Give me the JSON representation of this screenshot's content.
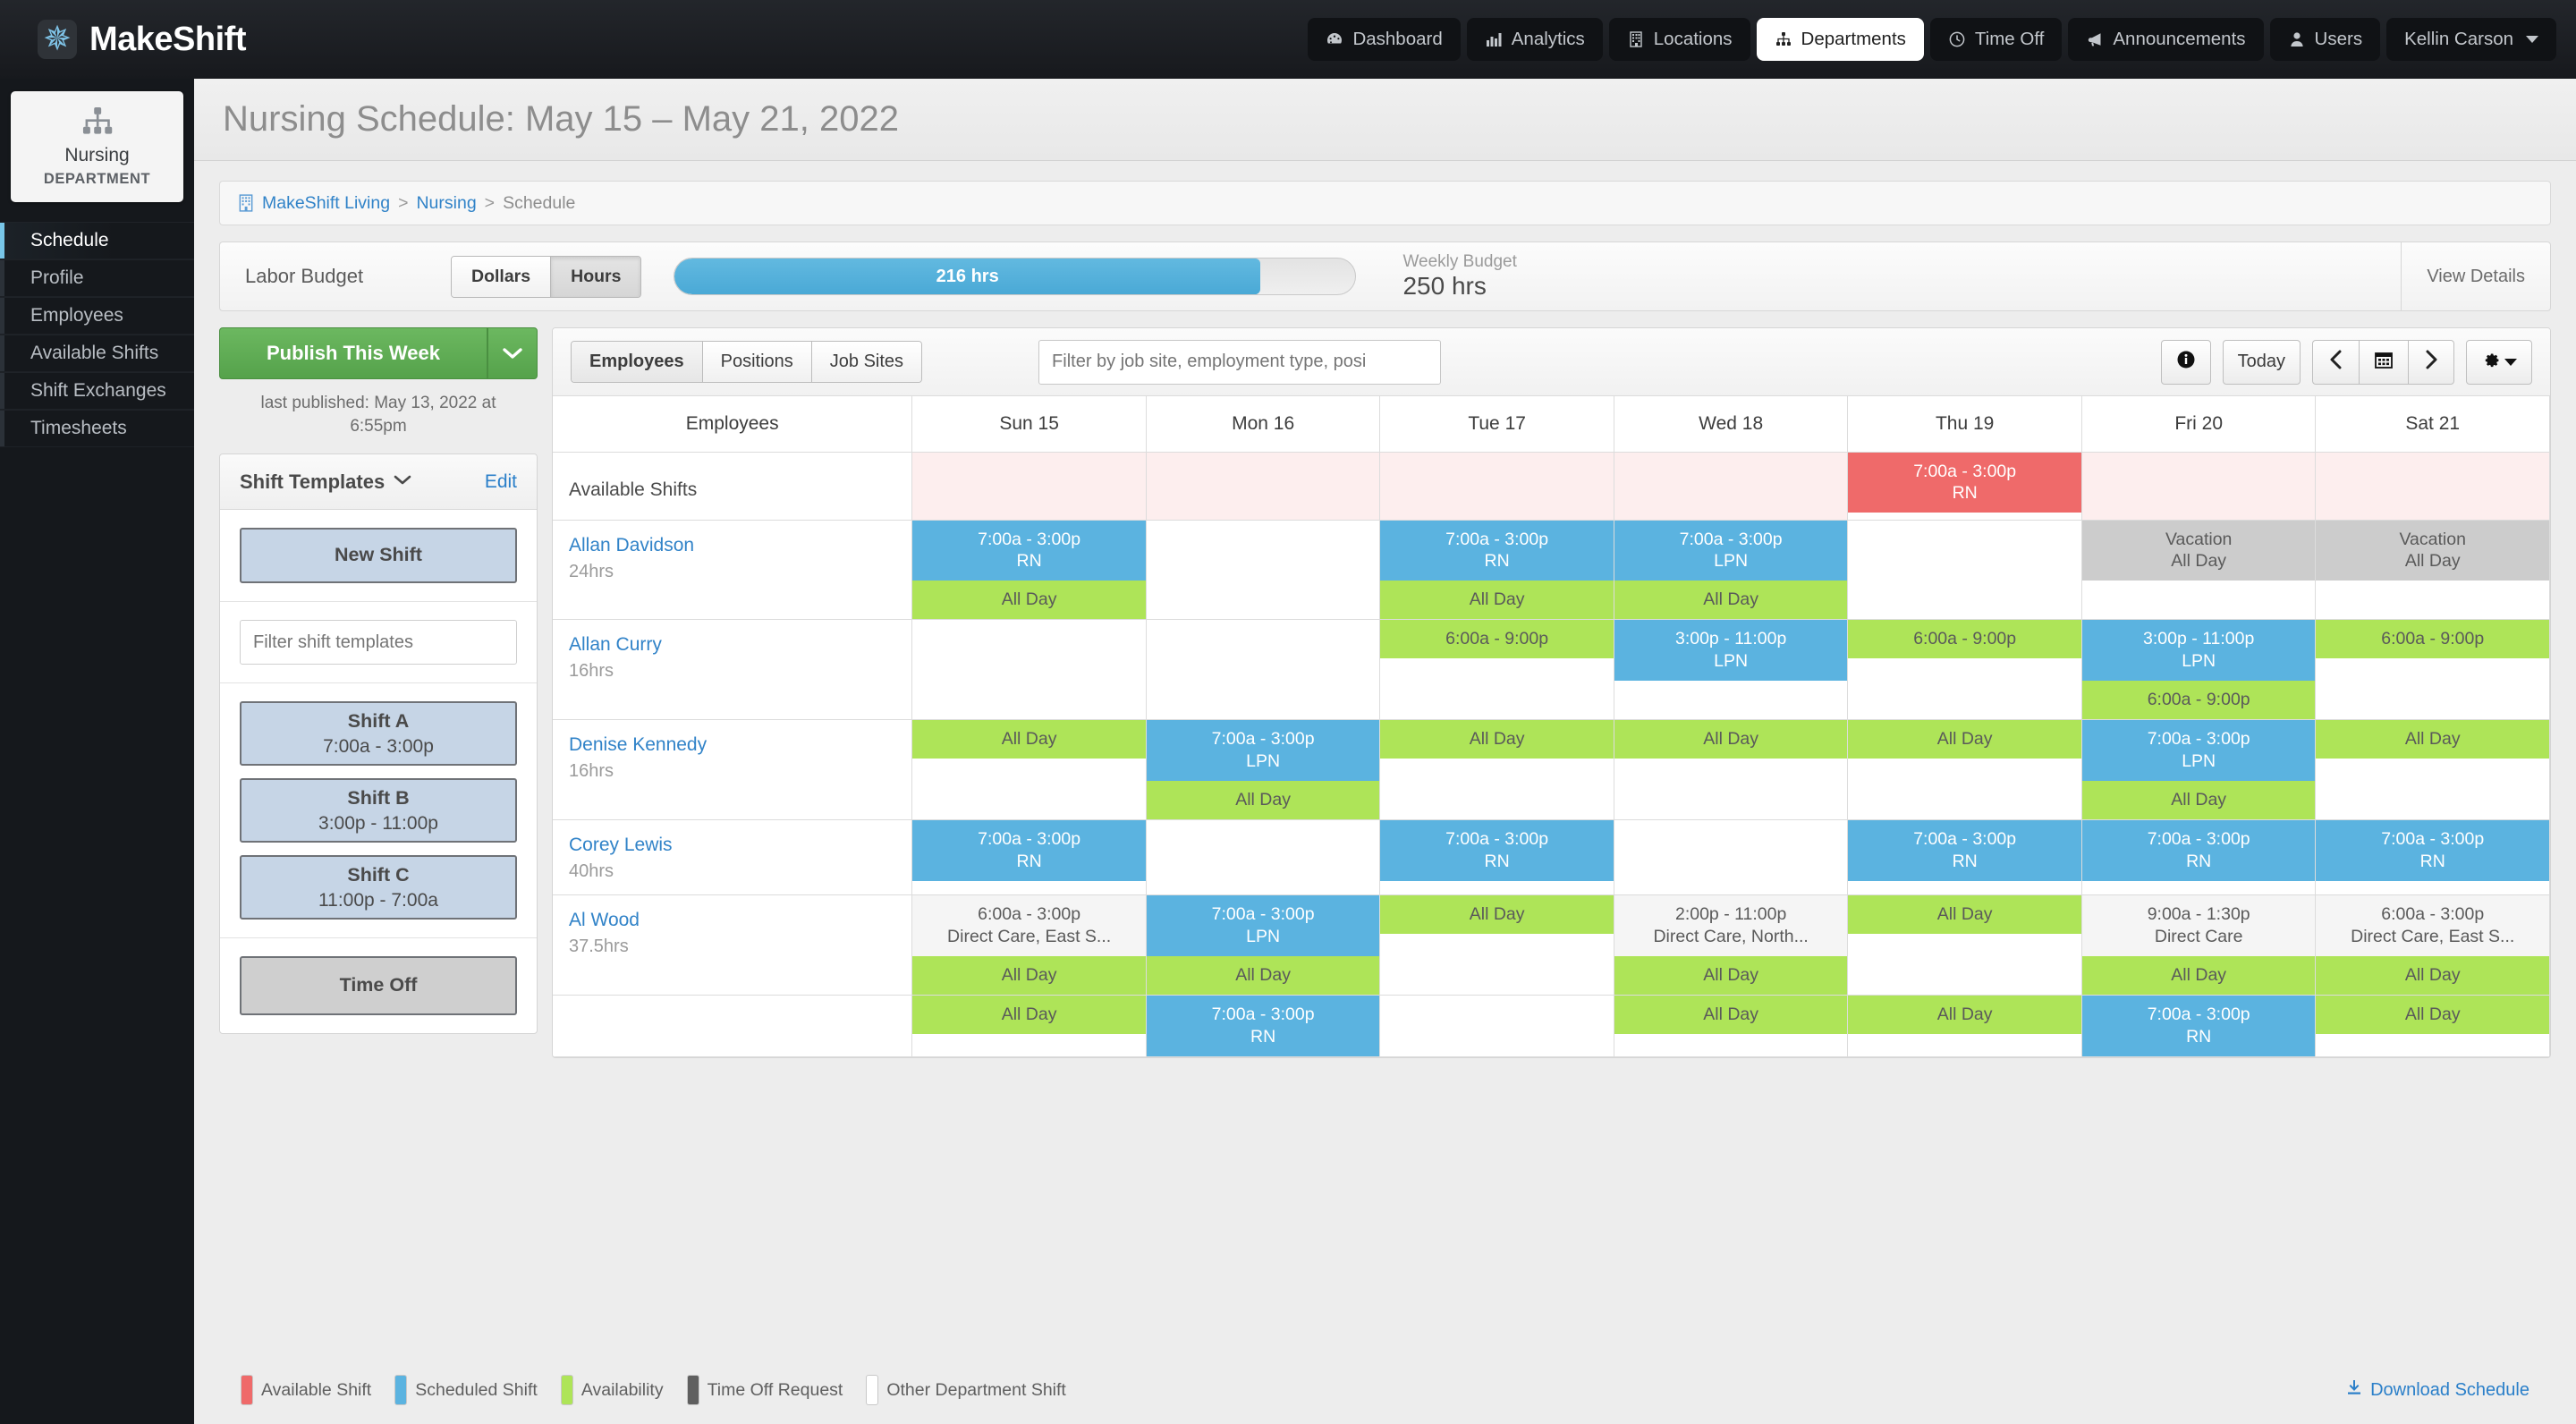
{
  "brand": {
    "name": "MakeShift",
    "logo_icon": "asterisk-icon"
  },
  "topnav": {
    "items": [
      {
        "label": "Dashboard",
        "icon": "dashboard-icon",
        "active": false
      },
      {
        "label": "Analytics",
        "icon": "bar-chart-icon",
        "active": false
      },
      {
        "label": "Locations",
        "icon": "building-icon",
        "active": false
      },
      {
        "label": "Departments",
        "icon": "sitemap-icon",
        "active": true
      },
      {
        "label": "Time Off",
        "icon": "clock-icon",
        "active": false
      },
      {
        "label": "Announcements",
        "icon": "megaphone-icon",
        "active": false
      },
      {
        "label": "Users",
        "icon": "user-icon",
        "active": false
      }
    ],
    "account": {
      "label": "Kellin Carson",
      "icon": "chevron-down-icon"
    }
  },
  "sidebar": {
    "department": {
      "name": "Nursing",
      "subtitle": "DEPARTMENT",
      "icon": "sitemap-icon"
    },
    "items": [
      {
        "label": "Schedule",
        "active": true
      },
      {
        "label": "Profile",
        "active": false
      },
      {
        "label": "Employees",
        "active": false
      },
      {
        "label": "Available Shifts",
        "active": false
      },
      {
        "label": "Shift Exchanges",
        "active": false
      },
      {
        "label": "Timesheets",
        "active": false
      }
    ]
  },
  "page": {
    "title": "Nursing Schedule: May 15 – May 21, 2022"
  },
  "breadcrumb": {
    "icon": "building-icon",
    "items": [
      {
        "label": "MakeShift Living",
        "link": true
      },
      {
        "label": "Nursing",
        "link": true
      },
      {
        "label": "Schedule",
        "link": false
      }
    ],
    "separator": ">"
  },
  "labor_budget": {
    "label": "Labor Budget",
    "toggle": [
      {
        "label": "Dollars",
        "active": false
      },
      {
        "label": "Hours",
        "active": true
      }
    ],
    "progress_text": "216 hrs",
    "progress_percent": 86,
    "weekly_budget_caption": "Weekly Budget",
    "weekly_budget_value": "250 hrs",
    "view_details": "View Details",
    "accent_color": "#4aa9d6"
  },
  "left_panel": {
    "publish_button": "Publish This Week",
    "publish_caret_icon": "chevron-down-icon",
    "last_published": "last published: May 13, 2022 at 6:55pm",
    "templates_panel": {
      "title": "Shift Templates",
      "title_caret_icon": "chevron-down-icon",
      "edit_label": "Edit",
      "new_shift_label": "New Shift",
      "filter_placeholder": "Filter shift templates",
      "templates": [
        {
          "name": "Shift A",
          "time": "7:00a - 3:00p",
          "style": "blue"
        },
        {
          "name": "Shift B",
          "time": "3:00p - 11:00p",
          "style": "blue"
        },
        {
          "name": "Shift C",
          "time": "11:00p - 7:00a",
          "style": "blue"
        }
      ],
      "time_off_label": "Time Off"
    }
  },
  "schedule": {
    "tabs": [
      {
        "label": "Employees",
        "active": true
      },
      {
        "label": "Positions",
        "active": false
      },
      {
        "label": "Job Sites",
        "active": false
      }
    ],
    "filter_placeholder": "Filter by job site, employment type, posi",
    "toolbar": {
      "info_icon": "info-icon",
      "today_label": "Today",
      "prev_icon": "chevron-left-icon",
      "calendar_icon": "calendar-icon",
      "next_icon": "chevron-right-icon",
      "settings_icon": "gear-icon",
      "settings_caret_icon": "caret-down-icon"
    },
    "columns": [
      "Employees",
      "Sun 15",
      "Mon 16",
      "Tue 17",
      "Wed 18",
      "Thu 19",
      "Fri 20",
      "Sat 21"
    ],
    "available_shifts_row": {
      "label": "Available Shifts",
      "cells": [
        {
          "chips": []
        },
        {
          "chips": []
        },
        {
          "chips": []
        },
        {
          "chips": []
        },
        {
          "chips": [
            {
              "style": "red",
              "line1": "7:00a - 3:00p",
              "line2": "RN"
            }
          ]
        },
        {
          "chips": []
        },
        {
          "chips": []
        }
      ]
    },
    "rows": [
      {
        "name": "Allan Davidson",
        "hours": "24hrs",
        "cells": [
          {
            "chips": [
              {
                "style": "blue",
                "line1": "7:00a - 3:00p",
                "line2": "RN"
              },
              {
                "style": "green",
                "line1": "All Day",
                "line2": ""
              }
            ]
          },
          {
            "chips": []
          },
          {
            "chips": [
              {
                "style": "blue",
                "line1": "7:00a - 3:00p",
                "line2": "RN"
              },
              {
                "style": "green",
                "line1": "All Day",
                "line2": ""
              }
            ]
          },
          {
            "chips": [
              {
                "style": "blue",
                "line1": "7:00a - 3:00p",
                "line2": "LPN"
              },
              {
                "style": "green",
                "line1": "All Day",
                "line2": ""
              }
            ]
          },
          {
            "chips": []
          },
          {
            "chips": [
              {
                "style": "gray",
                "line1": "Vacation",
                "line2": "All Day"
              }
            ]
          },
          {
            "chips": [
              {
                "style": "gray",
                "line1": "Vacation",
                "line2": "All Day"
              }
            ]
          }
        ]
      },
      {
        "name": "Allan Curry",
        "hours": "16hrs",
        "cells": [
          {
            "chips": []
          },
          {
            "chips": []
          },
          {
            "chips": [
              {
                "style": "green",
                "line1": "6:00a - 9:00p",
                "line2": ""
              }
            ]
          },
          {
            "chips": [
              {
                "style": "blue",
                "line1": "3:00p - 11:00p",
                "line2": "LPN"
              }
            ]
          },
          {
            "chips": [
              {
                "style": "green",
                "line1": "6:00a - 9:00p",
                "line2": ""
              }
            ]
          },
          {
            "chips": [
              {
                "style": "blue",
                "line1": "3:00p - 11:00p",
                "line2": "LPN"
              },
              {
                "style": "green",
                "line1": "6:00a - 9:00p",
                "line2": ""
              }
            ]
          },
          {
            "chips": [
              {
                "style": "green",
                "line1": "6:00a - 9:00p",
                "line2": ""
              }
            ]
          }
        ]
      },
      {
        "name": "Denise Kennedy",
        "hours": "16hrs",
        "cells": [
          {
            "chips": [
              {
                "style": "green",
                "line1": "All Day",
                "line2": ""
              }
            ]
          },
          {
            "chips": [
              {
                "style": "blue",
                "line1": "7:00a - 3:00p",
                "line2": "LPN"
              },
              {
                "style": "green",
                "line1": "All Day",
                "line2": ""
              }
            ]
          },
          {
            "chips": [
              {
                "style": "green",
                "line1": "All Day",
                "line2": ""
              }
            ]
          },
          {
            "chips": [
              {
                "style": "green",
                "line1": "All Day",
                "line2": ""
              }
            ]
          },
          {
            "chips": [
              {
                "style": "green",
                "line1": "All Day",
                "line2": ""
              }
            ]
          },
          {
            "chips": [
              {
                "style": "blue",
                "line1": "7:00a - 3:00p",
                "line2": "LPN"
              },
              {
                "style": "green",
                "line1": "All Day",
                "line2": ""
              }
            ]
          },
          {
            "chips": [
              {
                "style": "green",
                "line1": "All Day",
                "line2": ""
              }
            ]
          }
        ]
      },
      {
        "name": "Corey Lewis",
        "hours": "40hrs",
        "cells": [
          {
            "chips": [
              {
                "style": "blue",
                "line1": "7:00a - 3:00p",
                "line2": "RN"
              }
            ]
          },
          {
            "chips": []
          },
          {
            "chips": [
              {
                "style": "blue",
                "line1": "7:00a - 3:00p",
                "line2": "RN"
              }
            ]
          },
          {
            "chips": []
          },
          {
            "chips": [
              {
                "style": "blue",
                "line1": "7:00a - 3:00p",
                "line2": "RN"
              }
            ]
          },
          {
            "chips": [
              {
                "style": "blue",
                "line1": "7:00a - 3:00p",
                "line2": "RN"
              }
            ]
          },
          {
            "chips": [
              {
                "style": "blue",
                "line1": "7:00a - 3:00p",
                "line2": "RN"
              }
            ]
          }
        ]
      },
      {
        "name": "Al Wood",
        "hours": "37.5hrs",
        "cells": [
          {
            "chips": [
              {
                "style": "white",
                "line1": "6:00a - 3:00p",
                "line2": "Direct Care, East S..."
              },
              {
                "style": "green",
                "line1": "All Day",
                "line2": ""
              }
            ]
          },
          {
            "chips": [
              {
                "style": "blue",
                "line1": "7:00a - 3:00p",
                "line2": "LPN"
              },
              {
                "style": "green",
                "line1": "All Day",
                "line2": ""
              }
            ]
          },
          {
            "chips": [
              {
                "style": "green",
                "line1": "All Day",
                "line2": ""
              }
            ]
          },
          {
            "chips": [
              {
                "style": "white",
                "line1": "2:00p - 11:00p",
                "line2": "Direct Care, North..."
              },
              {
                "style": "green",
                "line1": "All Day",
                "line2": ""
              }
            ]
          },
          {
            "chips": [
              {
                "style": "green",
                "line1": "All Day",
                "line2": ""
              }
            ]
          },
          {
            "chips": [
              {
                "style": "white",
                "line1": "9:00a - 1:30p",
                "line2": "Direct Care"
              },
              {
                "style": "green",
                "line1": "All Day",
                "line2": ""
              }
            ]
          },
          {
            "chips": [
              {
                "style": "white",
                "line1": "6:00a - 3:00p",
                "line2": "Direct Care, East S..."
              },
              {
                "style": "green",
                "line1": "All Day",
                "line2": ""
              }
            ]
          }
        ]
      },
      {
        "name": "",
        "hours": "",
        "cells": [
          {
            "chips": [
              {
                "style": "green",
                "line1": "All Day",
                "line2": ""
              }
            ]
          },
          {
            "chips": [
              {
                "style": "blue",
                "line1": "7:00a - 3:00p",
                "line2": "RN"
              }
            ]
          },
          {
            "chips": []
          },
          {
            "chips": [
              {
                "style": "green",
                "line1": "All Day",
                "line2": ""
              }
            ]
          },
          {
            "chips": [
              {
                "style": "green",
                "line1": "All Day",
                "line2": ""
              }
            ]
          },
          {
            "chips": [
              {
                "style": "blue",
                "line1": "7:00a - 3:00p",
                "line2": "RN"
              }
            ]
          },
          {
            "chips": [
              {
                "style": "green",
                "line1": "All Day",
                "line2": ""
              }
            ]
          }
        ]
      }
    ]
  },
  "legend": {
    "items": [
      {
        "label": "Available Shift",
        "color": "#ef6a6a",
        "swatch": "sw-red"
      },
      {
        "label": "Scheduled Shift",
        "color": "#5bb3e0",
        "swatch": "sw-blue"
      },
      {
        "label": "Availability",
        "color": "#aee458",
        "swatch": "sw-green"
      },
      {
        "label": "Time Off Request",
        "color": "#5f5f5f",
        "swatch": "sw-gray"
      },
      {
        "label": "Other Department Shift",
        "color": "#ffffff",
        "swatch": "sw-white"
      }
    ],
    "download_label": "Download Schedule",
    "download_icon": "download-icon"
  }
}
